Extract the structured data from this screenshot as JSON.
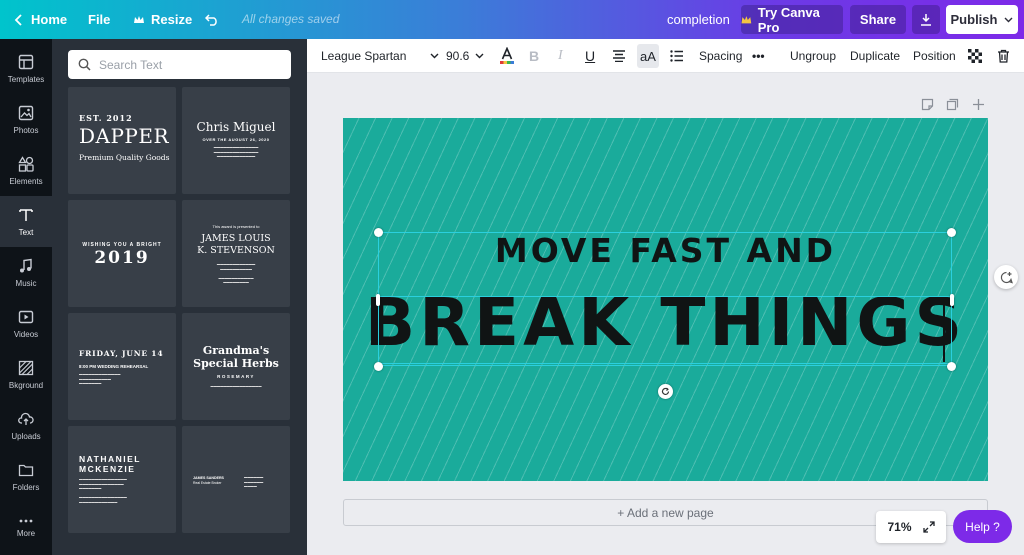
{
  "topbar": {
    "home": "Home",
    "file": "File",
    "resize": "Resize",
    "saved_status": "All changes saved",
    "doc_title": "completion",
    "try_pro": "Try Canva Pro",
    "share": "Share",
    "publish": "Publish"
  },
  "rail": {
    "items": [
      {
        "label": "Templates"
      },
      {
        "label": "Photos"
      },
      {
        "label": "Elements"
      },
      {
        "label": "Text"
      },
      {
        "label": "Music"
      },
      {
        "label": "Videos"
      },
      {
        "label": "Bkground"
      },
      {
        "label": "Uploads"
      },
      {
        "label": "Folders"
      },
      {
        "label": "More"
      }
    ]
  },
  "panel": {
    "search_placeholder": "Search Text",
    "templates": {
      "dapper": {
        "line1": "EST. 2012",
        "line2": "DAPPER",
        "line3": "Premium Quality Goods"
      },
      "chris": {
        "line1": "Chris Miguel",
        "line2": "OVER THE AUGUST 26, 2020"
      },
      "wishing": {
        "line1": "WISHING YOU A BRIGHT",
        "line2": "2019"
      },
      "james": {
        "line1": "This award is presented to",
        "line2": "JAMES LOUIS",
        "line3": "K. STEVENSON"
      },
      "friday": {
        "line1": "FRIDAY, JUNE 14",
        "line2": "8:00 PM WEDDING REHEARSAL"
      },
      "grandma": {
        "line1": "Grandma's",
        "line2": "Special Herbs",
        "line3": "ROSEMARY"
      },
      "nathaniel": {
        "line1": "NATHANIEL",
        "line2": "MCKENZIE"
      },
      "james2": {
        "line1": "JAMES SANDERS",
        "line2": "Real Estate Broker"
      }
    }
  },
  "toolbar2": {
    "font": "League Spartan",
    "size": "90.6",
    "spacing": "Spacing",
    "ungroup": "Ungroup",
    "duplicate": "Duplicate",
    "position": "Position",
    "case": "aA",
    "more": "•••"
  },
  "canvas": {
    "line1": "MOVE FAST AND",
    "line2": "BREAK THINGS",
    "add_page": "+ Add a new page",
    "bg_color": "#1aab9b"
  },
  "footer": {
    "zoom": "71%",
    "help": "Help ?"
  },
  "colors": {
    "accent": "#7d2ae8",
    "teal": "#00c4cc",
    "panel": "#293039"
  }
}
